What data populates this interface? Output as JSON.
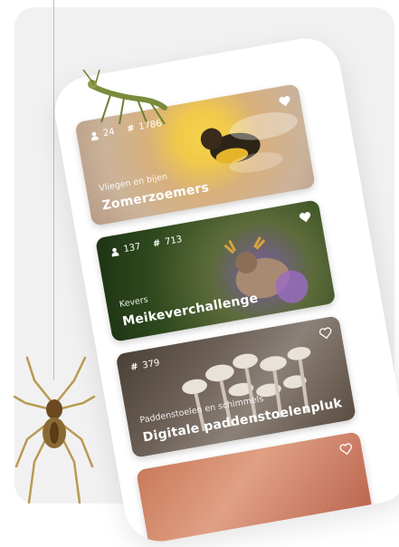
{
  "cards": [
    {
      "category": "Vliegen en bijen",
      "title": "Zomerzoemers",
      "participants": "24",
      "observations": "1786"
    },
    {
      "category": "Kevers",
      "title": "Meikeverchallenge",
      "participants": "137",
      "observations": "713"
    },
    {
      "category": "Paddenstoelen en schimmels",
      "title": "Digitale paddenstoelenpluk",
      "participants": "",
      "observations": "379"
    }
  ],
  "icons": {
    "participants": "user-icon",
    "observations": "hash-icon",
    "favorite": "heart-icon"
  },
  "colors": {
    "background": "#f1f1f1",
    "phone": "#ffffff",
    "text_on_image": "#ffffff"
  }
}
